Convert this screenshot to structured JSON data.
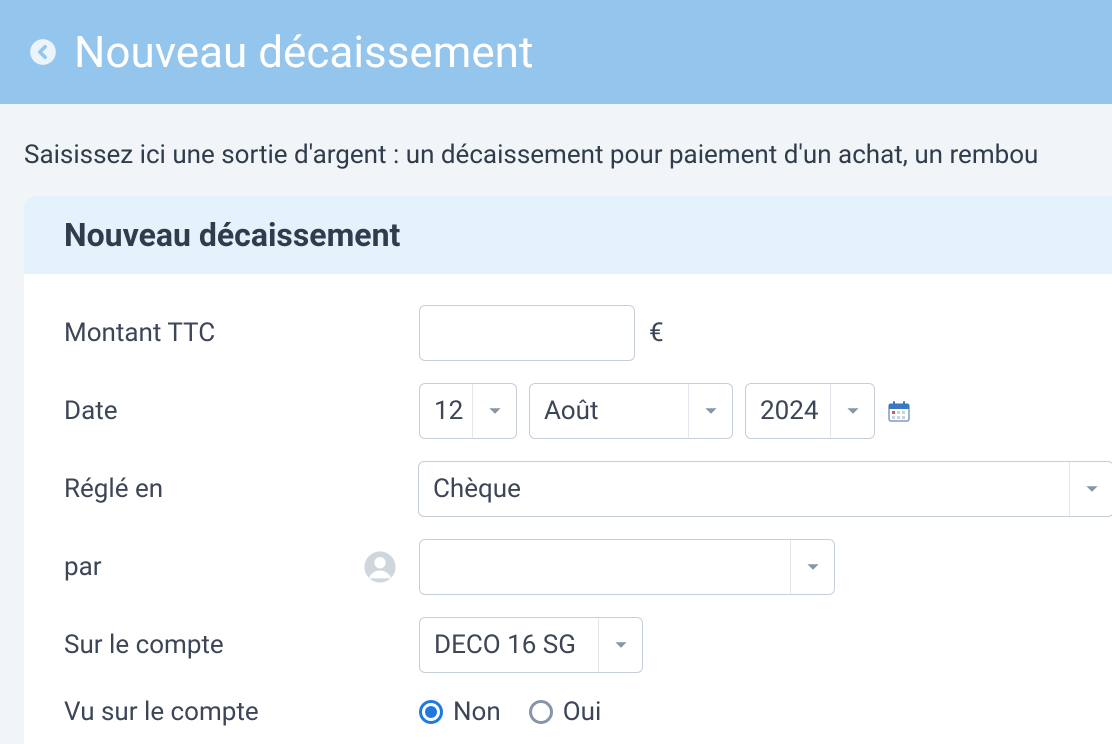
{
  "header": {
    "title": "Nouveau décaissement"
  },
  "intro": "Saisissez ici une sortie d'argent : un décaissement pour paiement d'un achat, un rembou",
  "card": {
    "title": "Nouveau décaissement"
  },
  "form": {
    "amount": {
      "label": "Montant TTC",
      "value": "",
      "currency": "€"
    },
    "date": {
      "label": "Date",
      "day": "12",
      "month": "Août",
      "year": "2024"
    },
    "paidIn": {
      "label": "Réglé en",
      "value": "Chèque"
    },
    "by": {
      "label": "par",
      "value": ""
    },
    "account": {
      "label": "Sur le compte",
      "value": "DECO 16 SG"
    },
    "seen": {
      "label": "Vu sur le compte",
      "options": {
        "no": "Non",
        "yes": "Oui"
      },
      "selected": "no"
    }
  }
}
